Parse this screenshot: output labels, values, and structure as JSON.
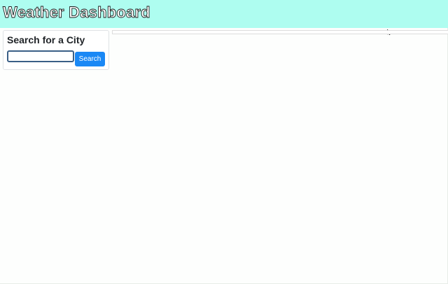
{
  "header": {
    "title": "Weather Dashboard",
    "background_color": "#aefdf0"
  },
  "search": {
    "heading": "Search for a City",
    "input_value": "",
    "input_placeholder": "",
    "button_label": "Search",
    "button_color": "#1a88f5"
  },
  "icons": {
    "cursor": "mouse-pointer-icon"
  }
}
